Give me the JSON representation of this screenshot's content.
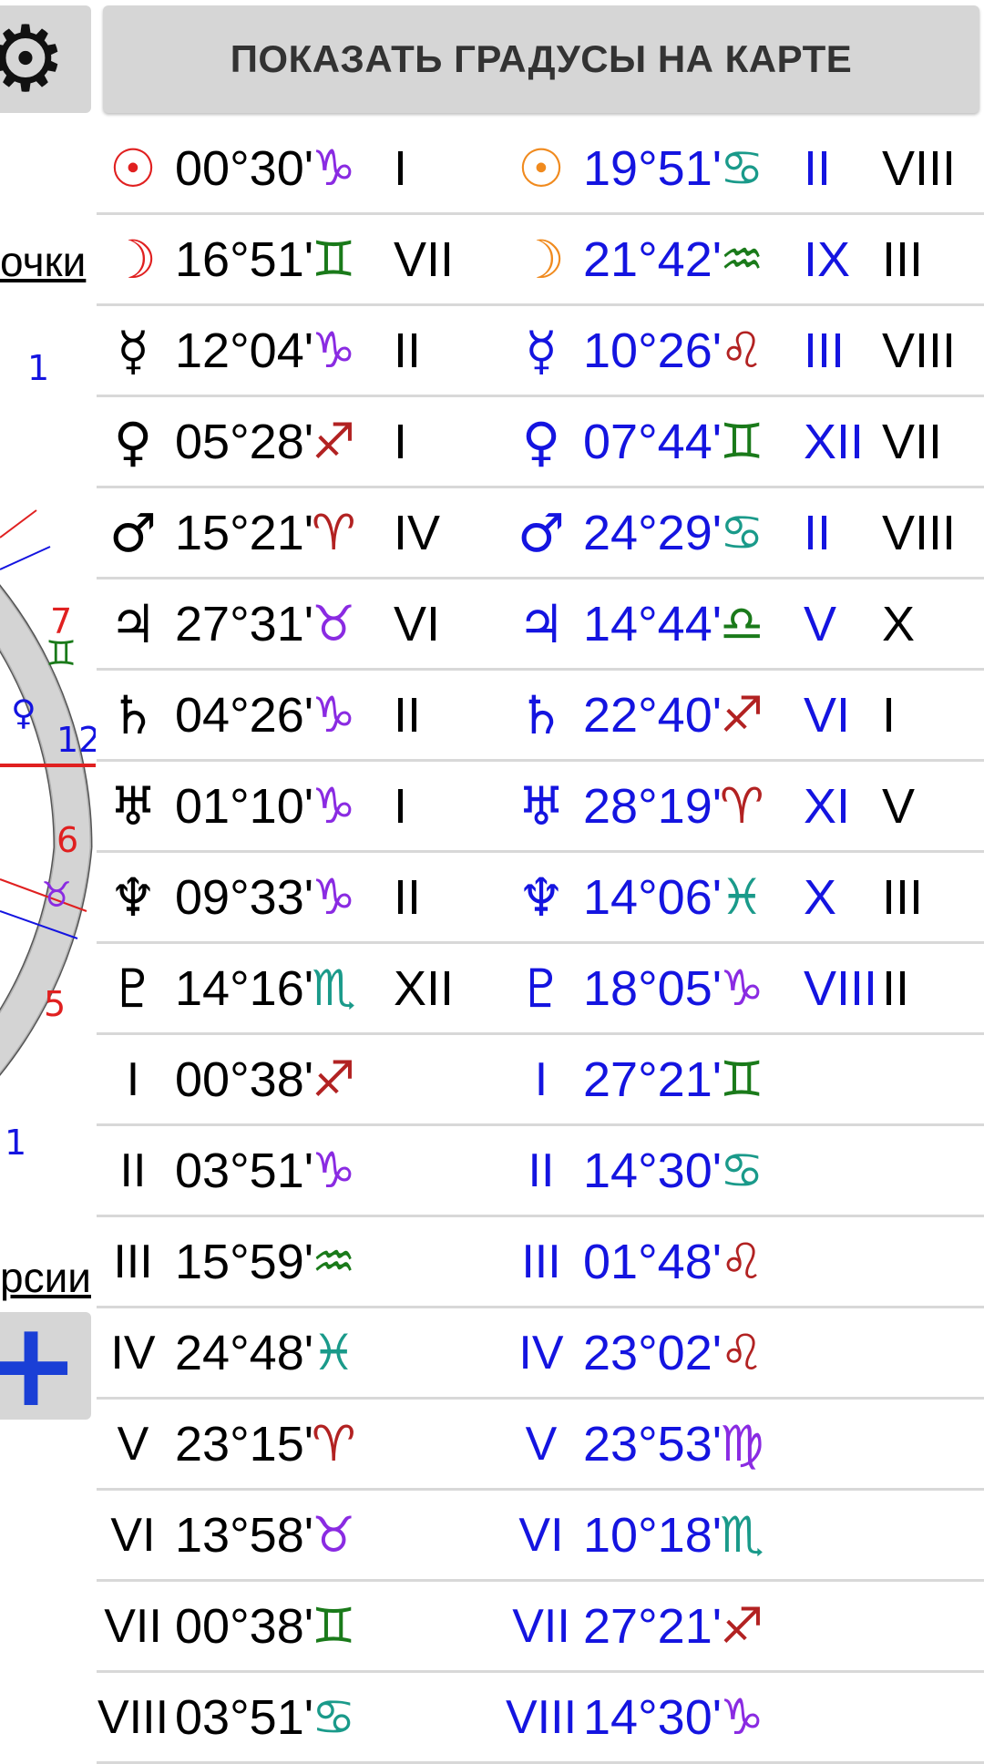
{
  "header": {
    "show_degrees_label": "ПОКАЗАТЬ ГРАДУСЫ НА КАРТЕ"
  },
  "side": {
    "gear_icon": "⚙",
    "link1": "очки",
    "link2": "рсии",
    "plus_icon": "+",
    "wheel_labels": [
      "1",
      "7",
      "♊",
      "♀",
      "12",
      "6",
      "♉",
      "5",
      "1"
    ]
  },
  "colors": {
    "natal_text": "#000000",
    "transit_text": "#1414e0",
    "aries": "#b22222",
    "taurus": "#8a2be2",
    "gemini": "#1a7a1a",
    "cancer": "#1a9a8a",
    "leo": "#b22222",
    "virgo": "#8a2be2",
    "libra": "#1a7a1a",
    "scorpio": "#1a9a8a",
    "sagittarius": "#b22222",
    "capricorn": "#8a2be2",
    "aquarius": "#1a7a1a",
    "pisces": "#1a9a8a"
  },
  "rows": [
    {
      "g1": "☉",
      "g1c": "#e02020",
      "d1": "00°30'",
      "s1": "♑",
      "s1c": "#8a2be2",
      "h1": "I",
      "g2": "☉",
      "g2c": "#f08a1e",
      "d2": "19°51'",
      "s2": "♋",
      "s2c": "#1a9a8a",
      "h2": "II",
      "h3": "VIII"
    },
    {
      "g1": "☽",
      "g1c": "#e02020",
      "d1": "16°51'",
      "s1": "♊",
      "s1c": "#1a7a1a",
      "h1": "VII",
      "g2": "☽",
      "g2c": "#f08a1e",
      "d2": "21°42'",
      "s2": "♒",
      "s2c": "#1a7a1a",
      "h2": "IX",
      "h3": "III"
    },
    {
      "g1": "☿",
      "g1c": "#000000",
      "d1": "12°04'",
      "s1": "♑",
      "s1c": "#8a2be2",
      "h1": "II",
      "g2": "☿",
      "g2c": "#1414e0",
      "d2": "10°26'",
      "s2": "♌",
      "s2c": "#b22222",
      "h2": "III",
      "h3": "VIII"
    },
    {
      "g1": "♀",
      "g1c": "#000000",
      "d1": "05°28'",
      "s1": "♐",
      "s1c": "#b22222",
      "h1": "I",
      "g2": "♀",
      "g2c": "#1414e0",
      "d2": "07°44'",
      "s2": "♊",
      "s2c": "#1a7a1a",
      "h2": "XII",
      "h3": "VII"
    },
    {
      "g1": "♂",
      "g1c": "#000000",
      "d1": "15°21'",
      "s1": "♈",
      "s1c": "#b22222",
      "h1": "IV",
      "g2": "♂",
      "g2c": "#1414e0",
      "d2": "24°29'",
      "s2": "♋",
      "s2c": "#1a9a8a",
      "h2": "II",
      "h3": "VIII"
    },
    {
      "g1": "♃",
      "g1c": "#000000",
      "d1": "27°31'",
      "s1": "♉",
      "s1c": "#8a2be2",
      "h1": "VI",
      "g2": "♃",
      "g2c": "#1414e0",
      "d2": "14°44'",
      "s2": "♎",
      "s2c": "#1a7a1a",
      "h2": "V",
      "h3": "X"
    },
    {
      "g1": "♄",
      "g1c": "#000000",
      "d1": "04°26'",
      "s1": "♑",
      "s1c": "#8a2be2",
      "h1": "II",
      "g2": "♄",
      "g2c": "#1414e0",
      "d2": "22°40'",
      "s2": "♐",
      "s2c": "#b22222",
      "h2": "VI",
      "h3": "I"
    },
    {
      "g1": "♅",
      "g1c": "#000000",
      "d1": "01°10'",
      "s1": "♑",
      "s1c": "#8a2be2",
      "h1": "I",
      "g2": "♅",
      "g2c": "#1414e0",
      "d2": "28°19'",
      "s2": "♈",
      "s2c": "#b22222",
      "h2": "XI",
      "h3": "V"
    },
    {
      "g1": "♆",
      "g1c": "#000000",
      "d1": "09°33'",
      "s1": "♑",
      "s1c": "#8a2be2",
      "h1": "II",
      "g2": "♆",
      "g2c": "#1414e0",
      "d2": "14°06'",
      "s2": "♓",
      "s2c": "#1a9a8a",
      "h2": "X",
      "h3": "III"
    },
    {
      "g1": "♇",
      "g1c": "#000000",
      "d1": "14°16'",
      "s1": "♏",
      "s1c": "#1a9a8a",
      "h1": "XII",
      "g2": "♇",
      "g2c": "#1414e0",
      "d2": "18°05'",
      "s2": "♑",
      "s2c": "#8a2be2",
      "h2": "VIII",
      "h3": "II"
    },
    {
      "g1": "I",
      "g1c": "#000000",
      "d1": "00°38'",
      "s1": "♐",
      "s1c": "#b22222",
      "h1": "",
      "g2": "I",
      "g2c": "#1414e0",
      "d2": "27°21'",
      "s2": "♊",
      "s2c": "#1a7a1a",
      "h2": "",
      "h3": ""
    },
    {
      "g1": "II",
      "g1c": "#000000",
      "d1": "03°51'",
      "s1": "♑",
      "s1c": "#8a2be2",
      "h1": "",
      "g2": "II",
      "g2c": "#1414e0",
      "d2": "14°30'",
      "s2": "♋",
      "s2c": "#1a9a8a",
      "h2": "",
      "h3": ""
    },
    {
      "g1": "III",
      "g1c": "#000000",
      "d1": "15°59'",
      "s1": "♒",
      "s1c": "#1a7a1a",
      "h1": "",
      "g2": "III",
      "g2c": "#1414e0",
      "d2": "01°48'",
      "s2": "♌",
      "s2c": "#b22222",
      "h2": "",
      "h3": ""
    },
    {
      "g1": "IV",
      "g1c": "#000000",
      "d1": "24°48'",
      "s1": "♓",
      "s1c": "#1a9a8a",
      "h1": "",
      "g2": "IV",
      "g2c": "#1414e0",
      "d2": "23°02'",
      "s2": "♌",
      "s2c": "#b22222",
      "h2": "",
      "h3": ""
    },
    {
      "g1": "V",
      "g1c": "#000000",
      "d1": "23°15'",
      "s1": "♈",
      "s1c": "#b22222",
      "h1": "",
      "g2": "V",
      "g2c": "#1414e0",
      "d2": "23°53'",
      "s2": "♍",
      "s2c": "#8a2be2",
      "h2": "",
      "h3": ""
    },
    {
      "g1": "VI",
      "g1c": "#000000",
      "d1": "13°58'",
      "s1": "♉",
      "s1c": "#8a2be2",
      "h1": "",
      "g2": "VI",
      "g2c": "#1414e0",
      "d2": "10°18'",
      "s2": "♏",
      "s2c": "#1a9a8a",
      "h2": "",
      "h3": ""
    },
    {
      "g1": "VII",
      "g1c": "#000000",
      "d1": "00°38'",
      "s1": "♊",
      "s1c": "#1a7a1a",
      "h1": "",
      "g2": "VII",
      "g2c": "#1414e0",
      "d2": "27°21'",
      "s2": "♐",
      "s2c": "#b22222",
      "h2": "",
      "h3": ""
    },
    {
      "g1": "VIII",
      "g1c": "#000000",
      "d1": "03°51'",
      "s1": "♋",
      "s1c": "#1a9a8a",
      "h1": "",
      "g2": "VIII",
      "g2c": "#1414e0",
      "d2": "14°30'",
      "s2": "♑",
      "s2c": "#8a2be2",
      "h2": "",
      "h3": ""
    }
  ]
}
